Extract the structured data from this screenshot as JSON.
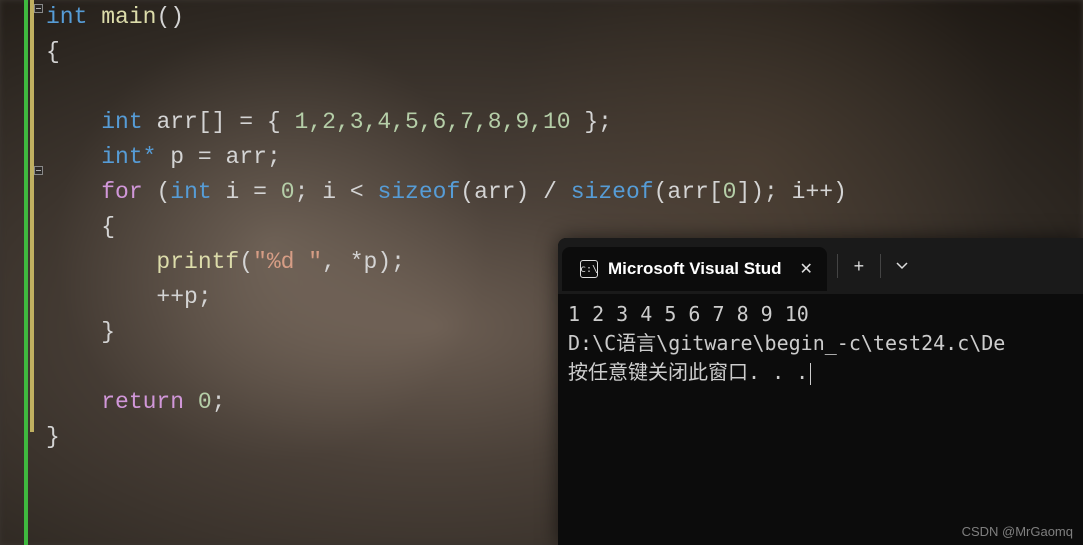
{
  "code": {
    "line1": {
      "t1": "int",
      "sp1": " ",
      "fn": "main",
      "paren": "()"
    },
    "line2": {
      "brace": "{"
    },
    "line4": {
      "indent": "    ",
      "t1": "int",
      "sp1": " ",
      "var": "arr",
      "brackets": "[]",
      "sp2": " ",
      "eq": "=",
      "sp3": " ",
      "ob": "{ ",
      "nums": "1,2,3,4,5,6,7,8,9,10",
      "cb": " };"
    },
    "line5": {
      "indent": "    ",
      "t1": "int",
      "star": "*",
      "sp1": " ",
      "var": "p",
      "sp2": " ",
      "eq": "=",
      "sp3": " ",
      "rhs": "arr",
      "semi": ";"
    },
    "line6": {
      "indent": "    ",
      "kw": "for",
      "sp1": " ",
      "op": "(",
      "t1": "int",
      "sp2": " ",
      "var": "i",
      "sp3": " ",
      "eq": "=",
      "sp4": " ",
      "n0": "0",
      "semi1": ";",
      "sp5": " ",
      "var2": "i",
      "sp6": " ",
      "lt": "<",
      "sp7": " ",
      "sz1": "sizeof",
      "op2": "(",
      "arr1": "arr",
      "cp1": ")",
      "sp8": " ",
      "div": "/",
      "sp9": " ",
      "sz2": "sizeof",
      "op3": "(",
      "arr2": "arr",
      "ob": "[",
      "z": "0",
      "cb": "]",
      "cp2": ");",
      "sp10": " ",
      "var3": "i",
      "inc": "++",
      "cp3": ")"
    },
    "line7": {
      "indent": "    ",
      "brace": "{"
    },
    "line8": {
      "indent": "        ",
      "fn": "printf",
      "op": "(",
      "str": "\"%d \"",
      "comma": ",",
      "sp": " ",
      "star": "*",
      "var": "p",
      "cp": ");"
    },
    "line9": {
      "indent": "        ",
      "inc": "++",
      "var": "p",
      "semi": ";"
    },
    "line10": {
      "indent": "    ",
      "brace": "}"
    },
    "line12": {
      "indent": "    ",
      "kw": "return",
      "sp": " ",
      "n": "0",
      "semi": ";"
    },
    "line13": {
      "brace": "}"
    }
  },
  "terminal": {
    "tab_title": "Microsoft Visual Stud",
    "output_line1": "1 2 3 4 5 6 7 8 9 10",
    "output_line2": "D:\\C语言\\gitware\\begin_-c\\test24.c\\De",
    "output_line3": "按任意键关闭此窗口. . ."
  },
  "watermark": "CSDN @MrGaomq"
}
